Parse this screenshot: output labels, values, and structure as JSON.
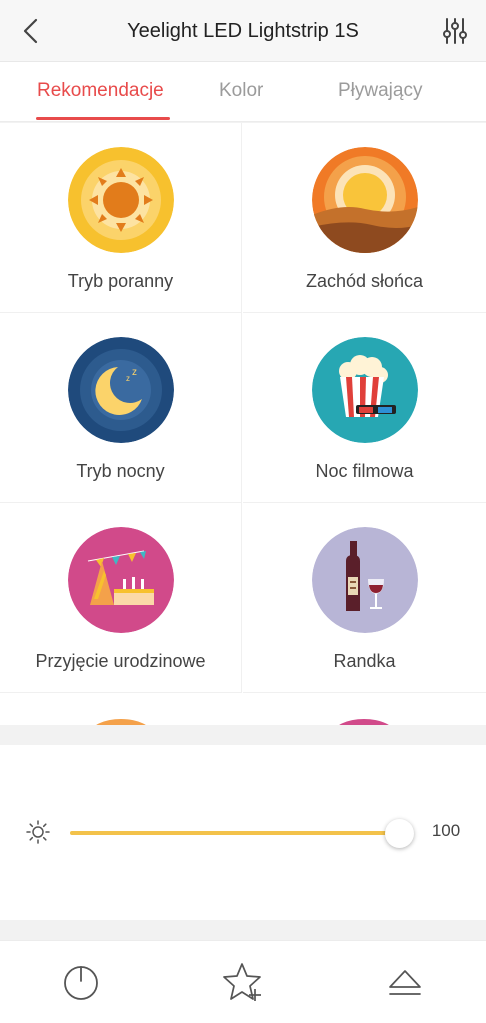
{
  "header": {
    "title": "Yeelight LED Lightstrip 1S",
    "back_icon": "chevron-left-icon",
    "settings_icon": "sliders-icon"
  },
  "tabs": [
    {
      "label": "Rekomendacje",
      "active": true
    },
    {
      "label": "Kolor",
      "active": false
    },
    {
      "label": "Pływający",
      "active": false
    }
  ],
  "scenes": [
    {
      "label": "Tryb poranny",
      "icon": "sunrise-icon"
    },
    {
      "label": "Zachód słońca",
      "icon": "sunset-icon"
    },
    {
      "label": "Tryb nocny",
      "icon": "moon-icon"
    },
    {
      "label": "Noc filmowa",
      "icon": "popcorn-icon"
    },
    {
      "label": "Przyjęcie urodzinowe",
      "icon": "birthday-cake-icon"
    },
    {
      "label": "Randka",
      "icon": "wine-icon"
    }
  ],
  "brightness": {
    "icon": "brightness-icon",
    "value": "100"
  },
  "bottom_bar": {
    "power_icon": "power-icon",
    "favorite_icon": "star-plus-icon",
    "eject_icon": "eject-icon"
  },
  "colors": {
    "accent": "#e84b4b",
    "slider": "#f3c24a"
  }
}
